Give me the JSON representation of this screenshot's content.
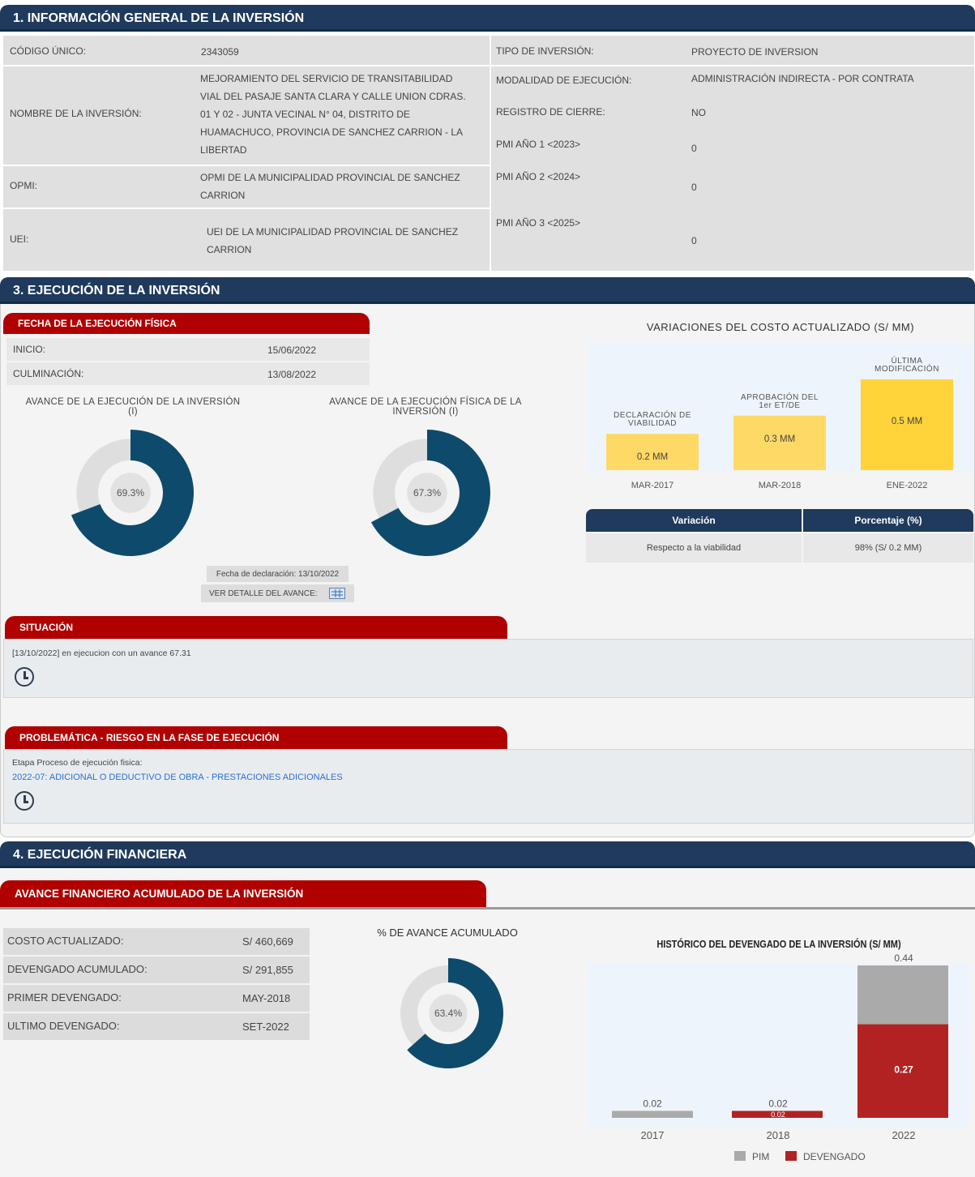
{
  "section1": {
    "title": "1. INFORMACIÓN GENERAL DE LA INVERSIÓN",
    "codigo_label": "CÓDIGO ÚNICO:",
    "codigo_value": "2343059",
    "nombre_label": "NOMBRE DE LA INVERSIÓN:",
    "nombre_lines": [
      "MEJORAMIENTO DEL SERVICIO DE TRANSITABILIDAD",
      "VIAL DEL PASAJE SANTA CLARA Y CALLE UNION CDRAS.",
      "01 Y 02 - JUNTA VECINAL N° 04, DISTRITO DE",
      "HUAMACHUCO, PROVINCIA DE SANCHEZ CARRION - LA",
      "LIBERTAD"
    ],
    "opmi_label": "OPMI:",
    "opmi_lines": [
      "OPMI DE LA MUNICIPALIDAD PROVINCIAL DE SANCHEZ",
      "CARRION"
    ],
    "uei_label": "UEI:",
    "uei_lines": [
      "UEI DE LA MUNICIPALIDAD PROVINCIAL DE SANCHEZ",
      "CARRION"
    ],
    "tipo_label": "TIPO DE INVERSIÓN:",
    "tipo_value": "PROYECTO DE INVERSION",
    "modalidad_label": "MODALIDAD DE EJECUCIÓN:",
    "modalidad_value": "ADMINISTRACIÓN INDIRECTA - POR CONTRATA",
    "registro_label": "REGISTRO DE CIERRE:",
    "registro_value": "NO",
    "pmi1_label": "PMI AÑO 1 <2023>",
    "pmi1_value": "0",
    "pmi2_label": "PMI AÑO 2 <2024>",
    "pmi2_value": "0",
    "pmi3_label": "PMI AÑO 3 <2025>",
    "pmi3_value": "0"
  },
  "section3": {
    "title": "3. EJECUCIÓN DE LA INVERSIÓN",
    "fecha_tab": "FECHA DE LA EJECUCIÓN FÍSICA",
    "inicio_label": "INICIO:",
    "inicio_value": "15/06/2022",
    "culminacion_label": "CULMINACIÓN:",
    "culminacion_value": "13/08/2022",
    "avance_inv_title_lines": [
      "AVANCE DE LA EJECUCIÓN DE LA INVERSIÓN",
      "(I)"
    ],
    "avance_inv_pct": 69.3,
    "avance_inv_label": "69.3%",
    "avance_fis_title_lines": [
      "AVANCE DE LA EJECUCIÓN FÍSICA DE LA",
      "INVERSIÓN (I)"
    ],
    "avance_fis_pct": 67.3,
    "avance_fis_label": "67.3%",
    "fecha_declaracion": "Fecha de declaración: 13/10/2022",
    "ver_detalle": "VER DETALLE DEL AVANCE:",
    "variaciones_title": "VARIACIONES DEL COSTO ACTUALIZADO (S/ MM)",
    "situacion_tab": "SITUACIÓN",
    "situacion_text": "[13/10/2022] en ejecucion con un avance 67.31",
    "problematica_tab": "PROBLEMÁTICA - RIESGO EN LA FASE DE EJECUCIÓN",
    "etapa_text": "Etapa Proceso de ejecución fisica:",
    "etapa_link": "2022-07: ADICIONAL O DEDUCTIVO DE OBRA - PRESTACIONES ADICIONALES",
    "variacion_header": "Variación",
    "porcentaje_header": "Porcentaje (%)",
    "respecto_label": "Respecto a la viabilidad",
    "respecto_value": "98% (S/ 0.2 MM)"
  },
  "section4": {
    "title": "4. EJECUCIÓN FINANCIERA",
    "avance_tab": "AVANCE FINANCIERO ACUMULADO DE LA INVERSIÓN",
    "rows": [
      {
        "label": "COSTO ACTUALIZADO:",
        "value": "S/ 460,669"
      },
      {
        "label": "DEVENGADO ACUMULADO:",
        "value": "S/ 291,855"
      },
      {
        "label": "PRIMER DEVENGADO:",
        "value": "MAY-2018"
      },
      {
        "label": "ULTIMO DEVENGADO:",
        "value": "SET-2022"
      }
    ],
    "pct_title": "% DE AVANCE ACUMULADO",
    "pct_value": 63.4,
    "pct_label": "63.4%",
    "historico_title": "HISTÓRICO DEL DEVENGADO DE LA INVERSIÓN (S/ MM)"
  },
  "colors": {
    "navy": "#1f3a5c",
    "teal": "#0e4a6b",
    "red": "#b00000",
    "yellow_light": "#ffd966",
    "yellow": "#ffd43b",
    "gray": "#aaaaaa",
    "darkred": "#b22222"
  },
  "chart_data": [
    {
      "type": "bar",
      "title": "VARIACIONES DEL COSTO ACTUALIZADO (S/ MM)",
      "categories": [
        "MAR-2017",
        "MAR-2018",
        "ENE-2022"
      ],
      "category_titles": [
        [
          "DECLARACIÓN DE",
          "VIABILIDAD"
        ],
        [
          "APROBACIÓN DEL",
          "1er ET/DE"
        ],
        [
          "ÚLTIMA",
          "MODIFICACIÓN"
        ]
      ],
      "values": [
        0.2,
        0.3,
        0.5
      ],
      "value_labels": [
        "0.2 MM",
        "0.3 MM",
        "0.5 MM"
      ]
    },
    {
      "type": "bar",
      "title": "HISTÓRICO DEL DEVENGADO DE LA INVERSIÓN (S/ MM)",
      "categories": [
        "2017",
        "2018",
        "2022"
      ],
      "series": [
        {
          "name": "PIM",
          "values": [
            0.02,
            0.02,
            0.44
          ],
          "labels": [
            "0.02",
            "0.02",
            "0.44"
          ]
        },
        {
          "name": "DEVENGADO",
          "values": [
            0,
            0.02,
            0.27
          ],
          "labels": [
            "",
            "0.02",
            "0.27"
          ]
        }
      ],
      "ylim": [
        0,
        0.44
      ]
    }
  ]
}
